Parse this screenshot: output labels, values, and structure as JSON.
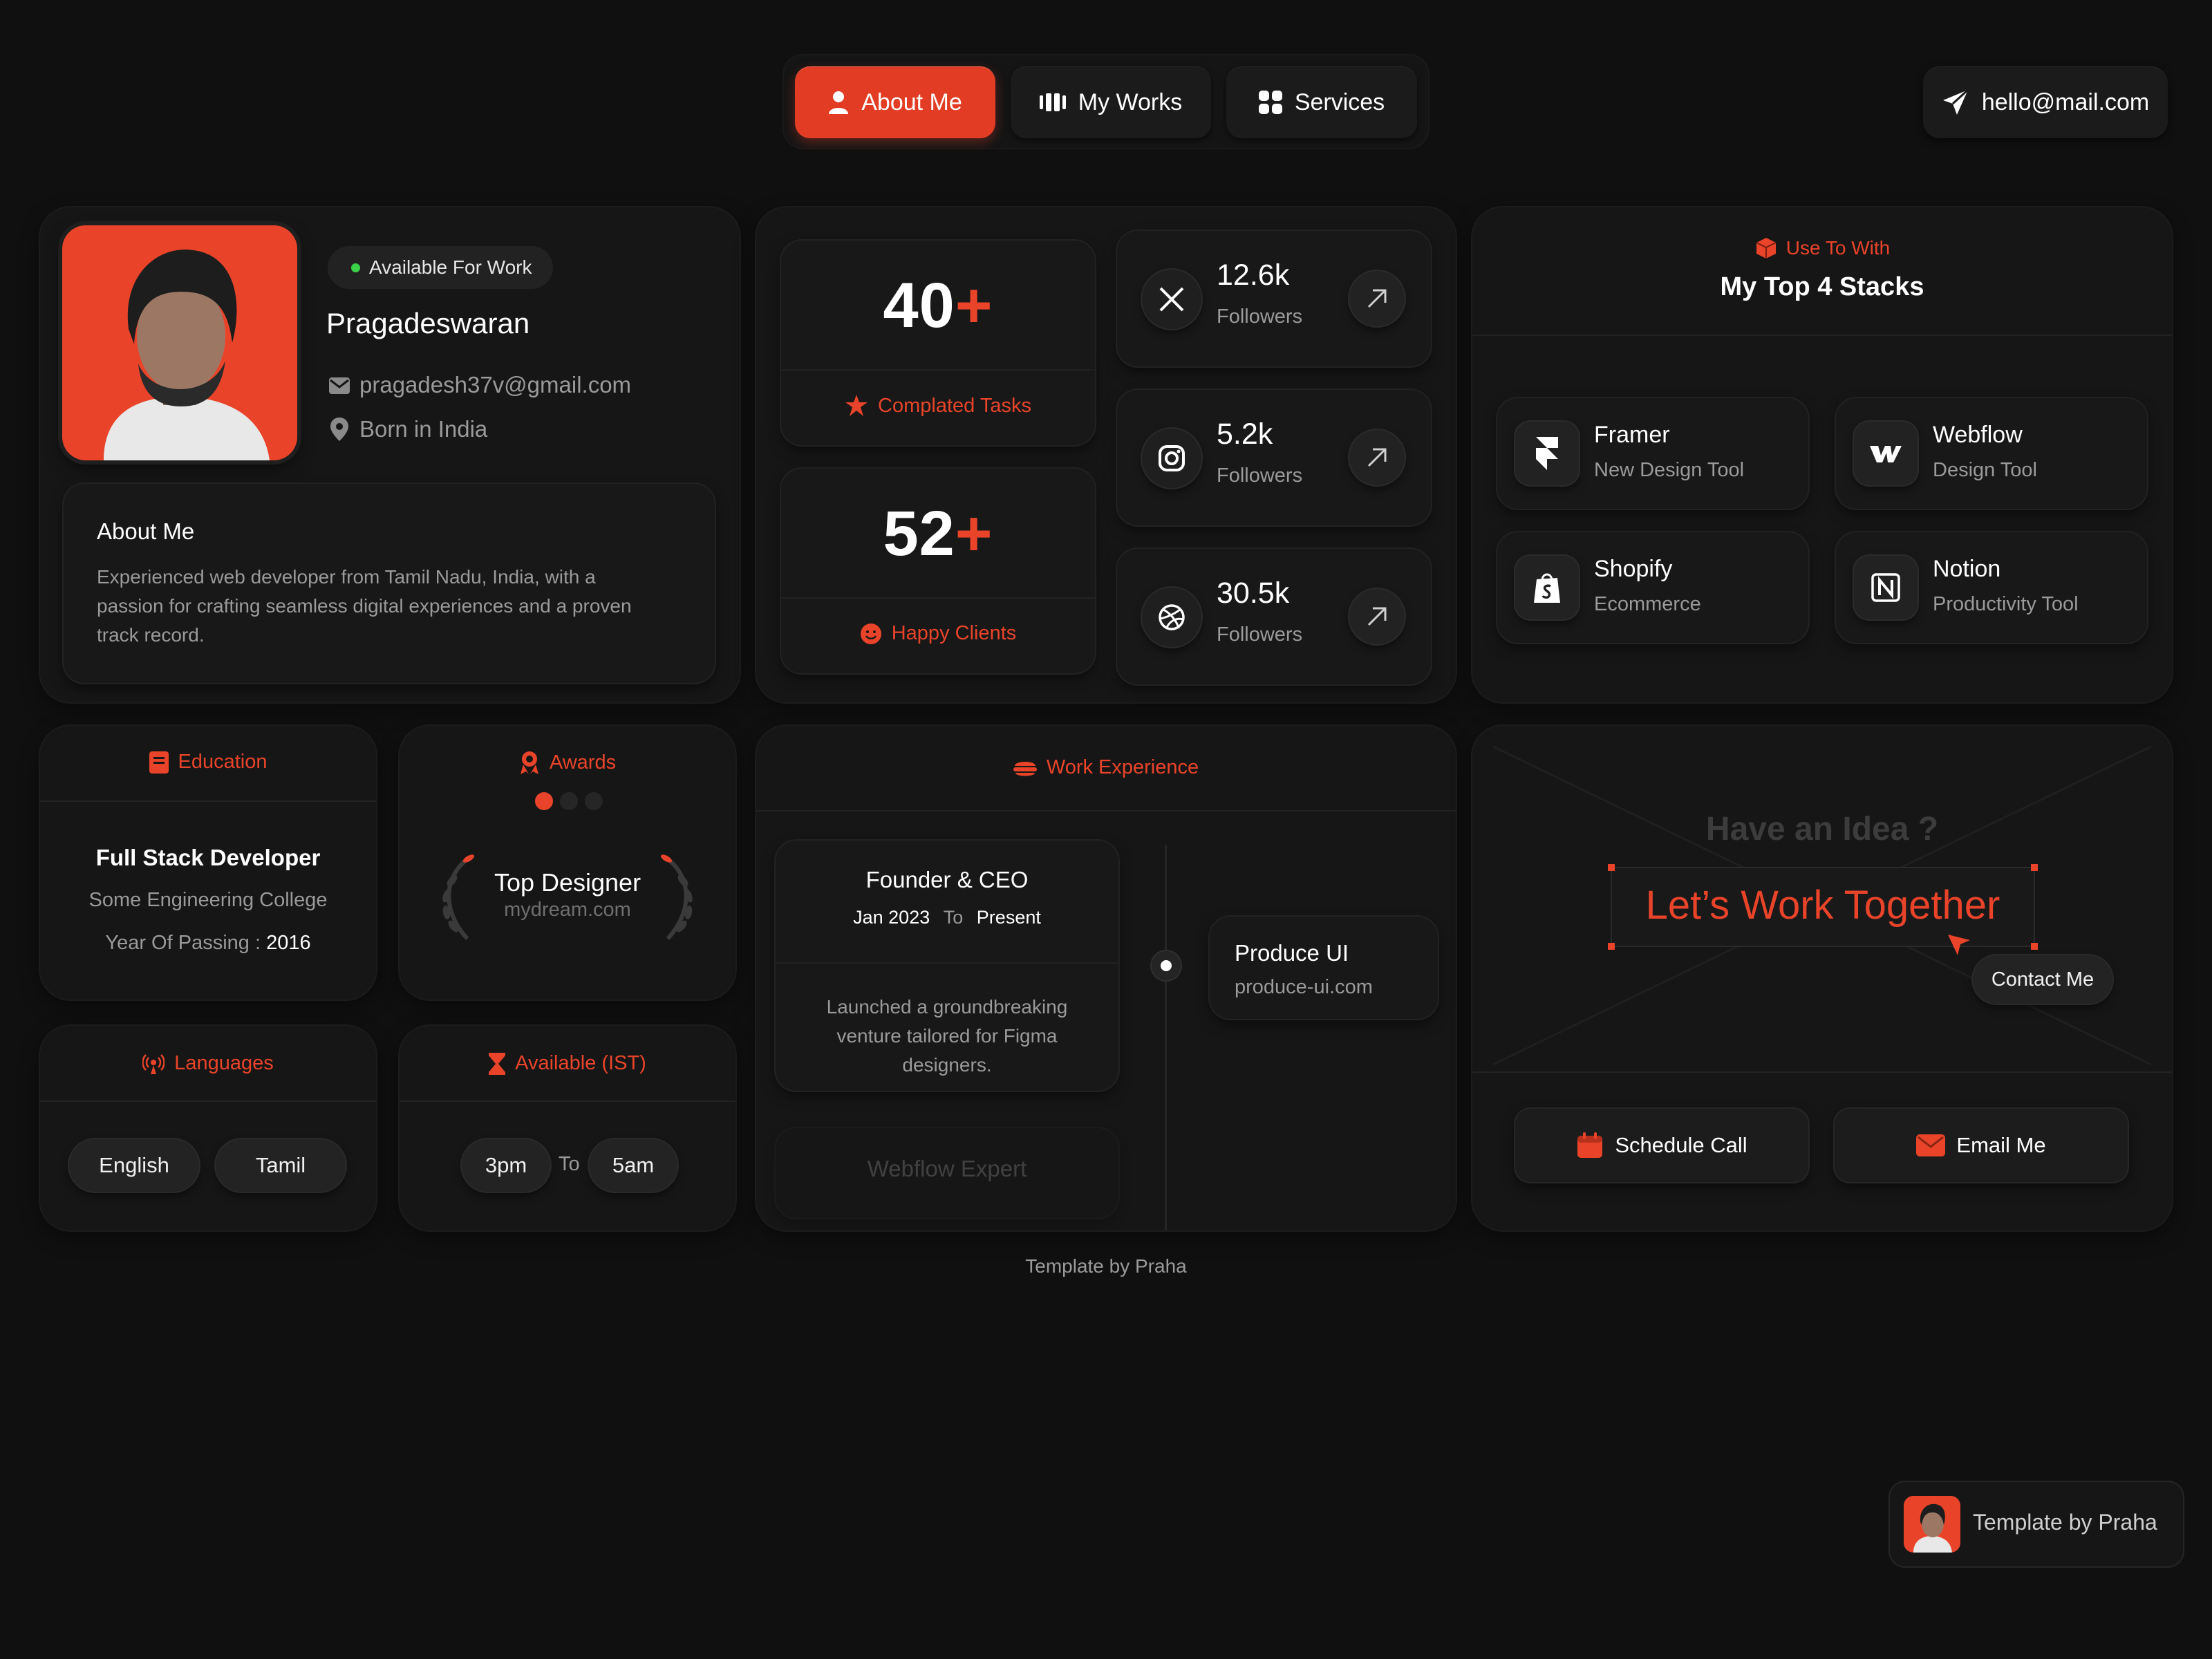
{
  "nav": {
    "about": "About Me",
    "works": "My Works",
    "services": "Services",
    "email": "hello@mail.com"
  },
  "profile": {
    "availability": "Available For Work",
    "name": "Pragadeswaran",
    "email": "pragadesh37v@gmail.com",
    "location": "Born in India",
    "about_title": "About Me",
    "about_text_1": "Experienced web developer from Tamil Nadu, India, with a",
    "about_text_2": "passion for crafting seamless digital experiences and a proven",
    "about_text_3": "track record."
  },
  "stats": [
    {
      "value": "40",
      "plus": "+",
      "label": "Complated Tasks"
    },
    {
      "value": "52",
      "plus": "+",
      "label": "Happy Clients"
    }
  ],
  "socials": [
    {
      "icon": "x-icon",
      "count": "12.6k",
      "label": "Followers"
    },
    {
      "icon": "instagram-icon",
      "count": "5.2k",
      "label": "Followers"
    },
    {
      "icon": "dribbble-icon",
      "count": "30.5k",
      "label": "Followers"
    }
  ],
  "stacks": {
    "kicker": "Use To With",
    "title": "My Top 4 Stacks",
    "items": [
      {
        "name": "Framer",
        "desc": "New Design Tool"
      },
      {
        "name": "Webflow",
        "desc": "Design Tool"
      },
      {
        "name": "Shopify",
        "desc": "Ecommerce"
      },
      {
        "name": "Notion",
        "desc": "Productivity Tool"
      }
    ]
  },
  "education": {
    "title": "Education",
    "degree": "Full Stack Developer",
    "college": "Some Engineering College",
    "year_label": "Year Of Passing :",
    "year": "2016"
  },
  "awards": {
    "title": "Awards",
    "name": "Top Designer",
    "site": "mydream.com"
  },
  "languages": {
    "title": "Languages",
    "items": [
      "English",
      "Tamil"
    ]
  },
  "availability": {
    "title": "Available (IST)",
    "from": "3pm",
    "to_label": "To",
    "to": "5am"
  },
  "experience": {
    "title": "Work Experience",
    "role": "Founder & CEO",
    "start": "Jan 2023",
    "to_label": "To",
    "end": "Present",
    "desc_1": "Launched a groundbreaking",
    "desc_2": "venture tailored for Figma",
    "desc_3": "designers.",
    "next_role": "Webflow Expert",
    "company": "Produce UI",
    "company_site": "produce-ui.com"
  },
  "cta": {
    "question": "Have an Idea ?",
    "headline": "Let’s Work Together",
    "contact": "Contact Me",
    "schedule": "Schedule Call",
    "email": "Email Me"
  },
  "footer": {
    "credit": "Template by Praha",
    "badge": "Template by Praha"
  },
  "colors": {
    "accent": "#e9442a",
    "background": "#101010",
    "card": "#161616",
    "available_dot": "#3bd14b"
  }
}
